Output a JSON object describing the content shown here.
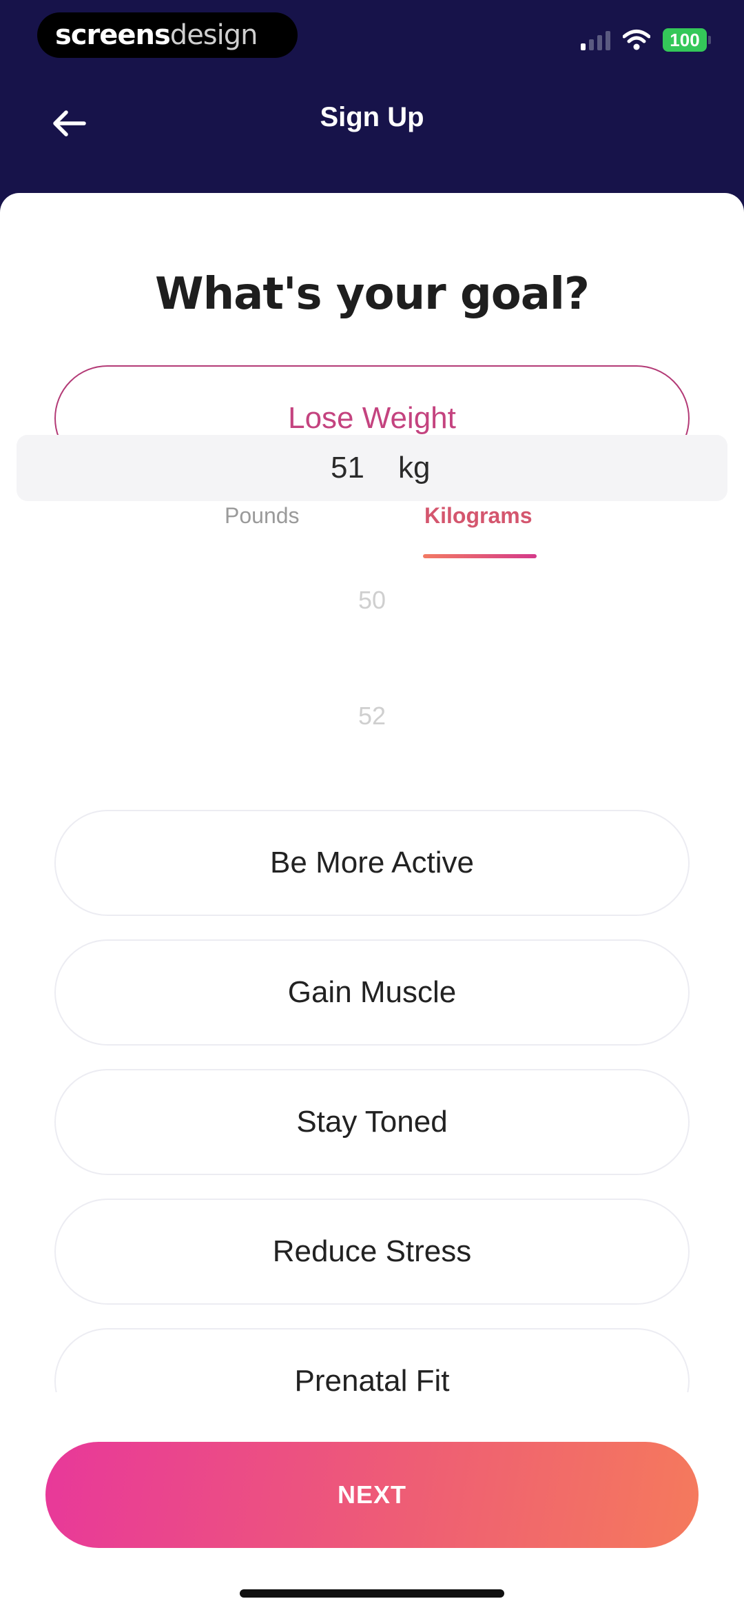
{
  "status_bar": {
    "brand_bold": "screens",
    "brand_light": "design",
    "battery": "100"
  },
  "nav": {
    "title": "Sign Up",
    "back_icon": "arrow-left-icon"
  },
  "question": "What's your goal?",
  "selected_goal": "Lose Weight",
  "unit_tabs": {
    "pounds": "Pounds",
    "kilograms": "Kilograms",
    "active": "Kilograms"
  },
  "weight_picker": {
    "previous": "50",
    "current": "51",
    "next": "52",
    "unit": "kg"
  },
  "goal_options": [
    "Be More Active",
    "Gain Muscle",
    "Stay Toned",
    "Reduce Stress",
    "Prenatal Fit"
  ],
  "next_label": "NEXT",
  "colors": {
    "header_bg": "#17134a",
    "accent_pink": "#c4437f",
    "button_gradient_start": "#e8389a",
    "button_gradient_end": "#f57a5c"
  }
}
